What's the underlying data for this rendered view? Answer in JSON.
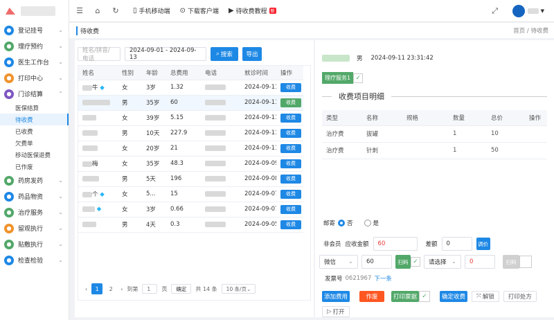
{
  "sidebar": {
    "items": [
      {
        "label": "登记挂号",
        "color": "#1e88e5",
        "open": false
      },
      {
        "label": "理疗预约",
        "color": "#52a869",
        "open": false
      },
      {
        "label": "医生工作台",
        "color": "#1e88e5",
        "open": false
      },
      {
        "label": "打印中心",
        "color": "#f0932b",
        "open": false
      },
      {
        "label": "门诊结算",
        "color": "#7e57c2",
        "open": true,
        "subs": [
          "医保结算",
          "待收费",
          "已收费",
          "欠费单",
          "移动医保退费",
          "已作废"
        ],
        "active": "待收费"
      },
      {
        "label": "药房发药",
        "color": "#52a869",
        "open": false
      },
      {
        "label": "药品物资",
        "color": "#1e88e5",
        "open": false
      },
      {
        "label": "治疗服务",
        "color": "#52a869",
        "open": false
      },
      {
        "label": "留观执行",
        "color": "#f0932b",
        "open": false
      },
      {
        "label": "贴敷执行",
        "color": "#52a869",
        "open": false
      },
      {
        "label": "检查检验",
        "color": "#1e88e5",
        "open": false
      }
    ]
  },
  "topbar": {
    "mobile": "手机移动端",
    "download": "下载客户端",
    "tutorial": "待收费教程",
    "new_badge": "新"
  },
  "tabbar": {
    "title": "待收费",
    "crumb_home": "首页",
    "crumb_sep": "/",
    "crumb_current": "待收费"
  },
  "search": {
    "placeholder": "姓名/拼音/电话",
    "date_range": "2024-09-01 - 2024-09-13",
    "search_label": "搜索",
    "export_label": "导出"
  },
  "table": {
    "headers": [
      "姓名",
      "性别",
      "年龄",
      "总费用",
      "电话",
      "就诊时间",
      "操作"
    ],
    "rows": [
      {
        "name": "牛",
        "gem": true,
        "sex": "女",
        "age": "3岁",
        "fee": "1.32",
        "date": "2024-09-11",
        "btn": "收费",
        "green": false,
        "sel": false
      },
      {
        "name": "",
        "gem": false,
        "sex": "男",
        "age": "35岁",
        "fee": "60",
        "date": "2024-09-11",
        "btn": "收费",
        "green": true,
        "sel": true
      },
      {
        "name": "",
        "gem": false,
        "sex": "女",
        "age": "39岁",
        "fee": "5.15",
        "date": "2024-09-11",
        "btn": "收费",
        "green": false,
        "sel": false
      },
      {
        "name": "",
        "gem": false,
        "sex": "男",
        "age": "10天",
        "fee": "227.9",
        "date": "2024-09-11",
        "btn": "收费",
        "green": false,
        "sel": false
      },
      {
        "name": "",
        "gem": false,
        "sex": "女",
        "age": "20岁",
        "fee": "21",
        "date": "2024-09-11",
        "btn": "收费",
        "green": false,
        "sel": false
      },
      {
        "name": "梅",
        "gem": false,
        "sex": "女",
        "age": "35岁",
        "fee": "48.3",
        "date": "2024-09-09",
        "btn": "收费",
        "green": false,
        "sel": false
      },
      {
        "name": "",
        "gem": false,
        "sex": "男",
        "age": "5天",
        "fee": "196",
        "date": "2024-09-08",
        "btn": "收费",
        "green": false,
        "sel": false
      },
      {
        "name": "个",
        "gem": true,
        "sex": "女",
        "age": "5...",
        "fee": "15",
        "date": "2024-09-07",
        "btn": "收费",
        "green": false,
        "sel": false
      },
      {
        "name": "",
        "gem": true,
        "sex": "女",
        "age": "3岁",
        "fee": "0.66",
        "date": "2024-09-07",
        "btn": "收费",
        "green": false,
        "sel": false
      },
      {
        "name": "",
        "gem": false,
        "sex": "男",
        "age": "4天",
        "fee": "0.3",
        "date": "2024-09-05",
        "btn": "收费",
        "green": false,
        "sel": false
      }
    ]
  },
  "pager": {
    "pages": [
      "1",
      "2"
    ],
    "goto": "到第",
    "page_input": "1",
    "page_unit": "页",
    "confirm": "确定",
    "total": "共 14 条",
    "size": "10 条/页"
  },
  "patient": {
    "sex": "男",
    "time": "2024-09-11 23:31:42",
    "service_tag": "理疗服务1"
  },
  "fees": {
    "title": "收费项目明细",
    "headers": [
      "类型",
      "名称",
      "规格",
      "数量",
      "总价",
      "操作"
    ],
    "rows": [
      {
        "type": "治疗费",
        "name": "拔罐",
        "spec": "",
        "qty": "1",
        "total": "10"
      },
      {
        "type": "治疗费",
        "name": "针刺",
        "spec": "",
        "qty": "1",
        "total": "50"
      }
    ]
  },
  "mail": {
    "label": "邮寄",
    "no": "否",
    "yes": "是"
  },
  "pay": {
    "member": "非会员",
    "due_label": "应收金额",
    "due": "60",
    "diff_label": "差额",
    "diff": "0",
    "adjust": "调价",
    "method": "微信",
    "amount": "60",
    "scan": "扫码",
    "choose": "请选择",
    "amount2": "0",
    "scan2": "扫码",
    "invoice_label": "发票号",
    "invoice": "0621967",
    "next": "下一条"
  },
  "actions": {
    "add_fee": "添加费用",
    "void": "作废",
    "print_ticket": "打印票据",
    "confirm": "确定收费",
    "unlock": "解锁",
    "print_rx": "打印处方",
    "open": "打开"
  }
}
